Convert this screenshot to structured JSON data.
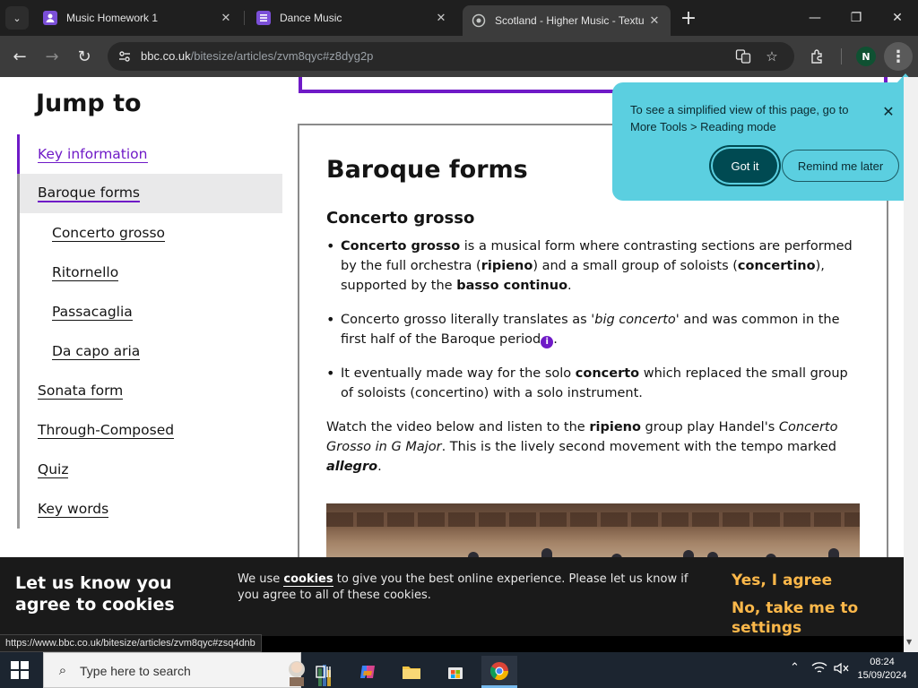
{
  "browser": {
    "tabs": [
      {
        "title": "Music Homework 1",
        "favicon_color": "#7b4fd8",
        "favicon_icon": "person-icon"
      },
      {
        "title": "Dance Music",
        "favicon_color": "#7b4fd8",
        "favicon_icon": "form-icon"
      },
      {
        "title": "Scotland - Higher Music - Textu",
        "favicon_color": "#9aa0a6",
        "favicon_icon": "globe-icon",
        "active": true
      }
    ],
    "new_tab_label": "+",
    "url_domain": "bbc.co.uk",
    "url_path": "/bitesize/articles/zvm8qyc#z8dyg2p",
    "profile_initial": "N"
  },
  "sidebar": {
    "title": "Jump to",
    "items": [
      {
        "label": "Key information"
      },
      {
        "label": "Baroque forms"
      },
      {
        "label": "Concerto grosso"
      },
      {
        "label": "Ritornello"
      },
      {
        "label": "Passacaglia"
      },
      {
        "label": "Da capo aria"
      },
      {
        "label": "Sonata form"
      },
      {
        "label": "Through-Composed"
      },
      {
        "label": "Quiz"
      },
      {
        "label": "Key words"
      }
    ]
  },
  "article": {
    "heading": "Baroque forms",
    "subheading": "Concerto grosso",
    "b1": {
      "t1": "Concerto grosso",
      "t2": " is a musical form where contrasting sections are performed by the full orchestra (",
      "t3": "ripieno",
      "t4": ") and a small group of soloists (",
      "t5": "concertino",
      "t6": "), supported by the ",
      "t7": "basso continuo",
      "t8": "."
    },
    "b2": {
      "t1": "Concerto grosso literally translates as ",
      "t2": "'big concerto'",
      "t3": " and was common in the first half of the Baroque period",
      "info": "i",
      "t4": "."
    },
    "b3": {
      "t1": "It eventually made way for the solo ",
      "t2": "concerto",
      "t3": " which replaced the small group of soloists (concertino) with a solo instrument."
    },
    "p": {
      "t1": "Watch the video below and listen to the ",
      "t2": "ripieno",
      "t3": " group play Handel's ",
      "t4": "Concerto Grosso in G Major",
      "t5": ". This is the lively second movement with the tempo marked ",
      "t6": "allegro",
      "t7": "."
    }
  },
  "popup": {
    "text": "To see a simplified view of this page, go to More Tools > Reading mode",
    "got_it": "Got it",
    "remind": "Remind me later",
    "color": "#5bcfe0"
  },
  "cookie": {
    "heading": "Let us know you agree to cookies",
    "text_pre": "We use ",
    "text_link": "cookies",
    "text_post": " to give you the best online experience. Please let us know if you agree to all of these cookies.",
    "yes": "Yes, I agree",
    "no": "No, take me to settings",
    "accent": "#fcb84a"
  },
  "status_url": "https://www.bbc.co.uk/bitesize/articles/zvm8qyc#zsq4dnb",
  "taskbar": {
    "search_placeholder": "Type here to search",
    "time": "08:24",
    "date": "15/09/2024"
  },
  "brand_purple": "#6f1ac7"
}
